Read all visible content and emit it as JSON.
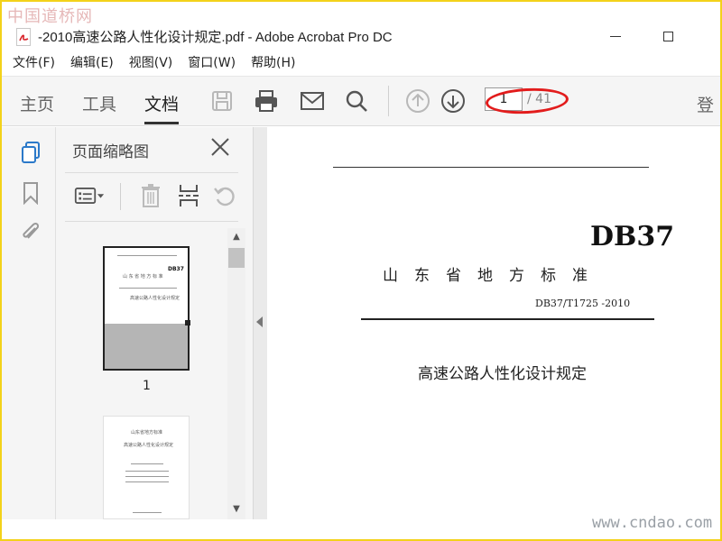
{
  "watermark_top": "中国道桥网",
  "window": {
    "title": "-2010高速公路人性化设计规定.pdf - Adobe Acrobat Pro DC"
  },
  "menu": [
    "文件(F)",
    "编辑(E)",
    "视图(V)",
    "窗口(W)",
    "帮助(H)"
  ],
  "toolbar": {
    "tabs": [
      "主页",
      "工具",
      "文档"
    ],
    "active_tab": "文档",
    "page_current": "1",
    "page_total": "/ 41",
    "login_label": "登"
  },
  "panel": {
    "title": "页面缩略图",
    "thumbnail_label": "1"
  },
  "document": {
    "code": "DB37",
    "org": "山东省地方标准",
    "standard_no": "DB37/T1725 -2010",
    "title": "高速公路人性化设计规定"
  },
  "watermark_bottom": "www.cndao.com",
  "colors": {
    "highlight_ellipse": "#e21c1c",
    "frame_border": "#f3d21a",
    "rail_active_icon": "#2b79c9"
  },
  "icons": [
    "pdf-file-icon",
    "save-icon",
    "print-icon",
    "mail-icon",
    "search-icon",
    "page-up-icon",
    "page-down-icon",
    "page-thumbnails-icon",
    "bookmark-icon",
    "attachment-icon",
    "close-icon",
    "options-icon",
    "delete-icon",
    "insert-page-icon",
    "rotate-icon"
  ]
}
